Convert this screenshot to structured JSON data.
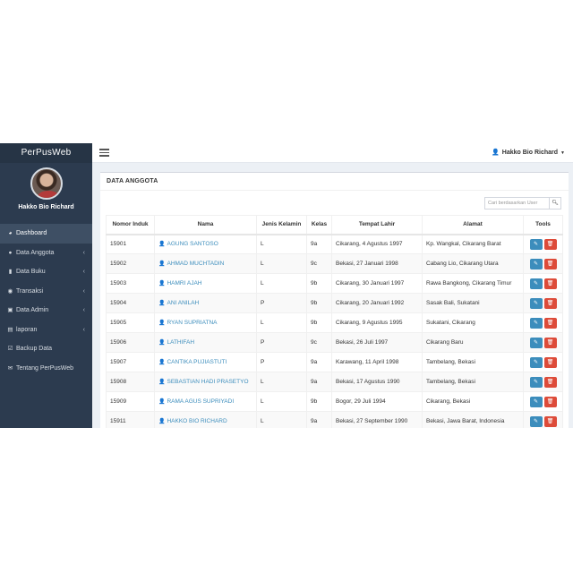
{
  "sidebar": {
    "brand": "PerPusWeb",
    "user_name": "Hakko Bio Richard",
    "items": [
      {
        "label": "Dashboard",
        "icon": "dashboard-icon",
        "glyph": "◕",
        "active": true,
        "chevron": ""
      },
      {
        "label": "Data Anggota",
        "icon": "users-icon",
        "glyph": "●",
        "active": false,
        "chevron": "‹"
      },
      {
        "label": "Data Buku",
        "icon": "book-icon",
        "glyph": "▮",
        "active": false,
        "chevron": "‹"
      },
      {
        "label": "Transaksi",
        "icon": "transaction-icon",
        "glyph": "◉",
        "active": false,
        "chevron": "‹"
      },
      {
        "label": "Data Admin",
        "icon": "lock-icon",
        "glyph": "▣",
        "active": false,
        "chevron": "‹"
      },
      {
        "label": "laporan",
        "icon": "file-icon",
        "glyph": "▤",
        "active": false,
        "chevron": "‹"
      },
      {
        "label": "Backup Data",
        "icon": "checkbox-icon",
        "glyph": "☑",
        "active": false,
        "chevron": ""
      },
      {
        "label": "Tentang PerPusWeb",
        "icon": "envelope-icon",
        "glyph": "✉",
        "active": false,
        "chevron": ""
      }
    ]
  },
  "header": {
    "user_name": "Hakko Bio Richard"
  },
  "main": {
    "title": "DATA ANGGOTA",
    "search_placeholder": "Cari berdasarkan User",
    "columns": [
      "Nomor Induk",
      "Nama",
      "Jenis Kelamin",
      "Kelas",
      "Tempat Lahir",
      "Alamat",
      "Tools"
    ],
    "rows": [
      {
        "nomor": "15901",
        "nama": "AGUNG SANTOSO",
        "jk": "L",
        "kelas": "9a",
        "lahir": "Cikarang, 4 Agustus 1997",
        "alamat": "Kp. Wangkal, Cikarang Barat"
      },
      {
        "nomor": "15902",
        "nama": "AHMAD MUCHTADIN",
        "jk": "L",
        "kelas": "9c",
        "lahir": "Bekasi, 27 Januari 1998",
        "alamat": "Cabang Lio, Cikarang Utara"
      },
      {
        "nomor": "15903",
        "nama": "HAMRI AJAH",
        "jk": "L",
        "kelas": "9b",
        "lahir": "Cikarang, 30 Januari 1997",
        "alamat": "Rawa Bangkong, Cikarang Timur"
      },
      {
        "nomor": "15904",
        "nama": "ANI ANILAH",
        "jk": "P",
        "kelas": "9b",
        "lahir": "Cikarang, 20 Januari 1992",
        "alamat": "Sasak Bali, Sukatani"
      },
      {
        "nomor": "15905",
        "nama": "RYAN SUPRIATNA",
        "jk": "L",
        "kelas": "9b",
        "lahir": "Cikarang, 9 Agustus 1995",
        "alamat": "Sukatani, Cikarang"
      },
      {
        "nomor": "15906",
        "nama": "LATHIFAH",
        "jk": "P",
        "kelas": "9c",
        "lahir": "Bekasi, 26 Juli 1997",
        "alamat": "Cikarang Baru"
      },
      {
        "nomor": "15907",
        "nama": "CANTIKA PUJIASTUTI",
        "jk": "P",
        "kelas": "9a",
        "lahir": "Karawang, 11 April 1998",
        "alamat": "Tambelang, Bekasi"
      },
      {
        "nomor": "15908",
        "nama": "SEBASTIAN HADI PRASETYO",
        "jk": "L",
        "kelas": "9a",
        "lahir": "Bekasi, 17 Agustus 1990",
        "alamat": "Tambelang, Bekasi"
      },
      {
        "nomor": "15909",
        "nama": "RAMA AGUS SUPRIYADI",
        "jk": "L",
        "kelas": "9b",
        "lahir": "Bogor, 29 Juli 1994",
        "alamat": "Cikarang, Bekasi"
      },
      {
        "nomor": "15911",
        "nama": "HAKKO BIO RICHARD",
        "jk": "L",
        "kelas": "9a",
        "lahir": "Bekasi, 27 September 1990",
        "alamat": "Bekasi, Jawa Barat, Indonesia"
      }
    ]
  },
  "colors": {
    "sidebar_bg": "#2c3b4f",
    "brand_bg": "#263445",
    "link": "#3c8dbc",
    "edit_button": "#3c8dbc",
    "delete_button": "#dd4b39"
  }
}
